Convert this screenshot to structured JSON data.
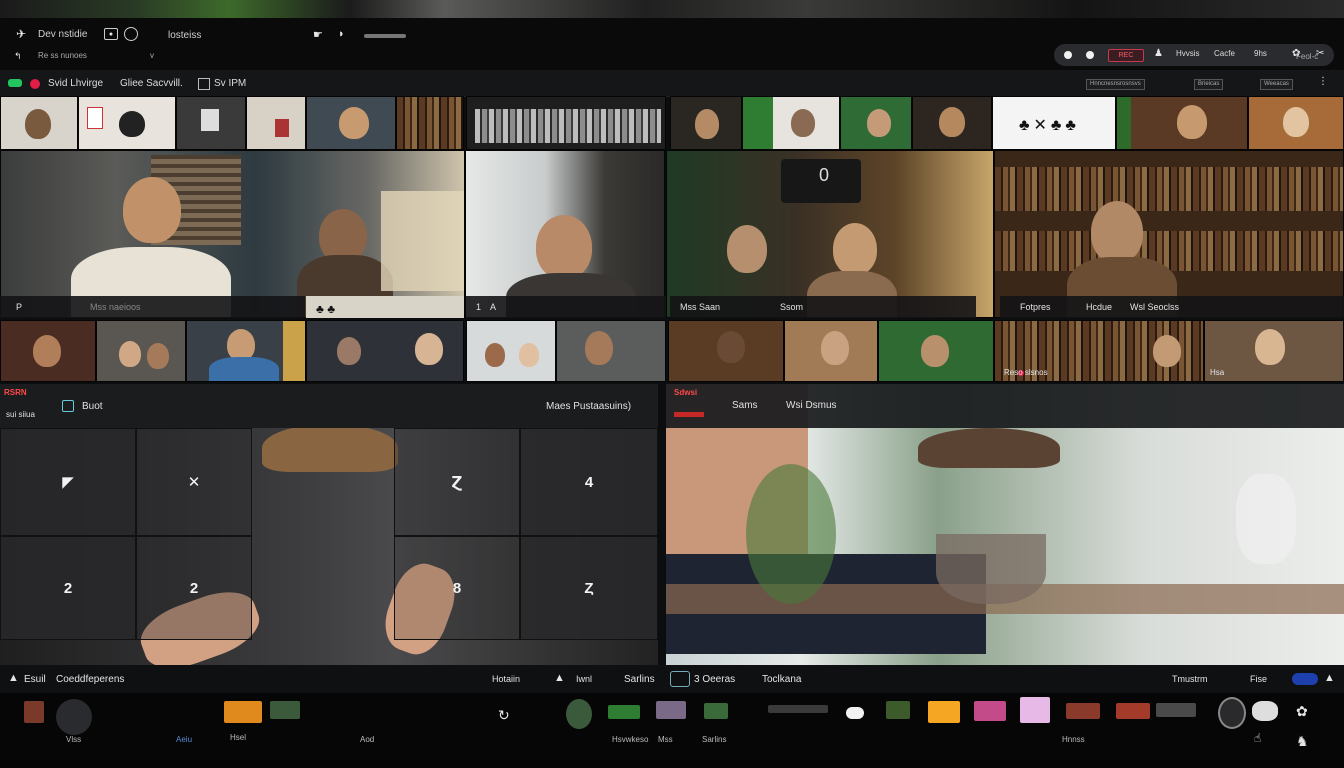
{
  "topbar": {
    "app_title": "Dev nstidie",
    "app_sub": "Re ss nunoes",
    "mid_label": "losteiss",
    "user_label": "v",
    "right_sub": "Feol-c",
    "pill": {
      "rec": "REC",
      "items": [
        "Hvvsis",
        "Cacfe",
        "9hs"
      ]
    }
  },
  "subbar": {
    "items": [
      "Svid Lhvirge",
      "Gliee Sacvvill.",
      "Sv IPM"
    ],
    "right_buttons": [
      "Hnncnesnsrosnsvs",
      "Brieicas",
      "Weeacas"
    ]
  },
  "tiles": {
    "row2_labels": [
      "Mss naeioos",
      "A",
      "Ssom",
      "Mss Saan",
      "Fotpres",
      "Hcdue",
      "Wsl Seoclss"
    ],
    "row2_numbers": [
      "P",
      "1",
      "0"
    ],
    "row3_labels": [
      "Reso slsnos",
      "Hsa"
    ]
  },
  "left_pane": {
    "badge": "RSRN",
    "sub": "sui siiua",
    "title": "Buot",
    "right": "Maes Pustaasuins)",
    "cells": [
      "◤",
      "✕",
      "Ɀ",
      "4",
      "2",
      "2",
      "8",
      "Ȥ"
    ]
  },
  "right_pane": {
    "badge": "Sdwsi",
    "title_a": "Sams",
    "title_b": "Wsi Dsmus"
  },
  "dock": {
    "left_title": "Esuil",
    "left_title2": "Coeddfeperens",
    "mid_a": "Hotaiin",
    "mid_b": "Iwnl",
    "mid_c": "Sarlins",
    "mid_d": "3 Oeeras",
    "mid_e": "Toclkana",
    "right_label": "Tmustrm",
    "right_chip": "Fise",
    "thumb_labels": [
      "Vlss",
      "Aeiu",
      "Hsel",
      "Aod",
      "Hsvwkeso",
      "Mss",
      "Sarlins",
      "Hnnss"
    ]
  }
}
